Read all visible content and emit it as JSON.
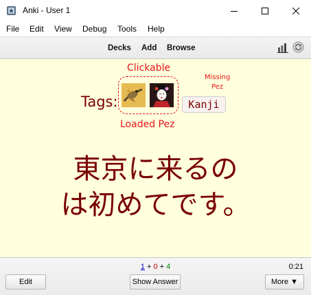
{
  "window": {
    "title": "Anki - User 1"
  },
  "menu": [
    "File",
    "Edit",
    "View",
    "Debug",
    "Tools",
    "Help"
  ],
  "toolbar": {
    "links": [
      "Decks",
      "Add",
      "Browse"
    ],
    "icons": [
      "stats-icon",
      "sync-icon"
    ]
  },
  "card": {
    "tags_label": "Tags:",
    "annotation_clickable": "Clickable",
    "annotation_missing": "Missing\nPez",
    "annotation_loaded": "Loaded Pez",
    "tag_text": "Kanji",
    "question_line1": "東京に来るの",
    "question_line2": "は初めてです。"
  },
  "bottom": {
    "count_new": "1",
    "count_learn": "0",
    "count_review": "4",
    "plus": "+",
    "timer": "0:21",
    "edit_label": "Edit",
    "show_answer_label": "Show Answer",
    "more_label": "More ▼"
  },
  "colors": {
    "card_bg": "#ffffdd",
    "question_text": "#7a0000",
    "annotation": "#e8141a"
  }
}
